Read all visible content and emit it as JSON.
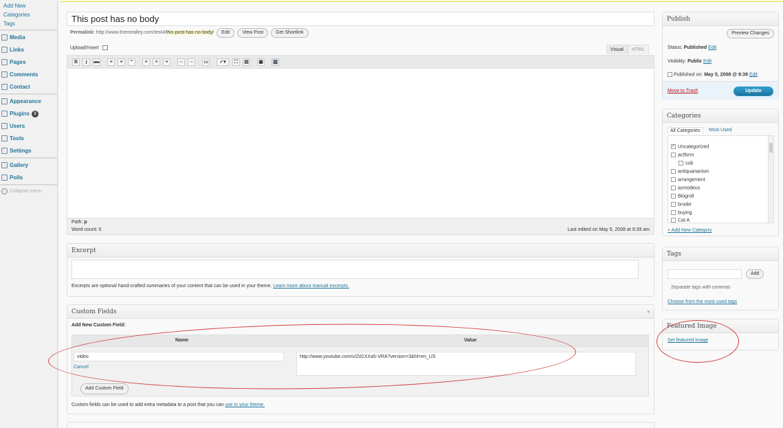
{
  "sidebar": {
    "posts_sub": [
      "Add New",
      "Categories",
      "Tags"
    ],
    "menu": [
      {
        "label": "Media",
        "icon": "media-icon"
      },
      {
        "label": "Links",
        "icon": "links-icon"
      },
      {
        "label": "Pages",
        "icon": "pages-icon"
      },
      {
        "label": "Comments",
        "icon": "comments-icon"
      },
      {
        "label": "Contact",
        "icon": "contact-icon"
      },
      {
        "label": "Appearance",
        "icon": "appearance-icon"
      },
      {
        "label": "Plugins",
        "icon": "plugins-icon",
        "badge": "3"
      },
      {
        "label": "Users",
        "icon": "users-icon"
      },
      {
        "label": "Tools",
        "icon": "tools-icon"
      },
      {
        "label": "Settings",
        "icon": "settings-icon"
      },
      {
        "label": "Gallery",
        "icon": "gallery-icon"
      },
      {
        "label": "Polls",
        "icon": "polls-icon"
      }
    ],
    "collapse_label": "Collapse menu"
  },
  "post": {
    "title": "This post has no body",
    "permalink_label": "Permalink:",
    "permalink_base": "http://www.themealley.com/test4/",
    "permalink_slug": "this-post-has-no-body/",
    "buttons": {
      "edit": "Edit",
      "view": "View Post",
      "shortlink": "Get Shortlink"
    }
  },
  "editor": {
    "upload_label": "Upload/Insert",
    "tab_visual": "Visual",
    "tab_html": "HTML",
    "path_label": "Path:",
    "path_value": "p",
    "word_count": "Word count: 0",
    "last_edited": "Last edited on May 5, 2008 at 9:39 am"
  },
  "excerpt": {
    "heading": "Excerpt",
    "note": "Excerpts are optional hand-crafted summaries of your content that can be used in your theme.",
    "learn_more": "Learn more about manual excerpts."
  },
  "custom_fields": {
    "heading": "Custom Fields",
    "add_new_label": "Add New Custom Field:",
    "col_name": "Name",
    "col_value": "Value",
    "name_value": "video",
    "value_value": "http://www.youtube.com/v/Zd1XXa5-VRA?version=3&hl=en_US",
    "cancel": "Cancel",
    "add_button": "Add Custom Field",
    "note": "Custom fields can be used to add extra metadata to a post that you can",
    "note_link": "use in your theme."
  },
  "publish": {
    "heading": "Publish",
    "preview": "Preview Changes",
    "status_label": "Status:",
    "status_value": "Published",
    "visibility_label": "Visibility:",
    "visibility_value": "Public",
    "published_label": "Published on:",
    "published_value": "May 5, 2008 @ 9:39",
    "edit": "Edit",
    "trash": "Move to Trash",
    "update": "Update"
  },
  "categories": {
    "heading": "Categories",
    "tab_all": "All Categories",
    "tab_most": "Most Used",
    "items": [
      {
        "label": "Uncategorized",
        "checked": true,
        "indent": false
      },
      {
        "label": "actform",
        "checked": false,
        "indent": false
      },
      {
        "label": "sub",
        "checked": false,
        "indent": true
      },
      {
        "label": "antiquarianism",
        "checked": false,
        "indent": false
      },
      {
        "label": "arrangement",
        "checked": false,
        "indent": false
      },
      {
        "label": "asmodeus",
        "checked": false,
        "indent": false
      },
      {
        "label": "Blogroll",
        "checked": false,
        "indent": false
      },
      {
        "label": "broder",
        "checked": false,
        "indent": false
      },
      {
        "label": "buying",
        "checked": false,
        "indent": false
      },
      {
        "label": "Cat A",
        "checked": false,
        "indent": false
      }
    ],
    "add_new": "+ Add New Category"
  },
  "tags": {
    "heading": "Tags",
    "add": "Add",
    "hint": "Separate tags with commas",
    "choose": "Choose from the most used tags"
  },
  "featured": {
    "heading": "Featured Image",
    "set_link": "Set featured image"
  },
  "colors": {
    "link": "#21759b",
    "annotation": "#d43c3c",
    "primary_button": "#21759b"
  }
}
